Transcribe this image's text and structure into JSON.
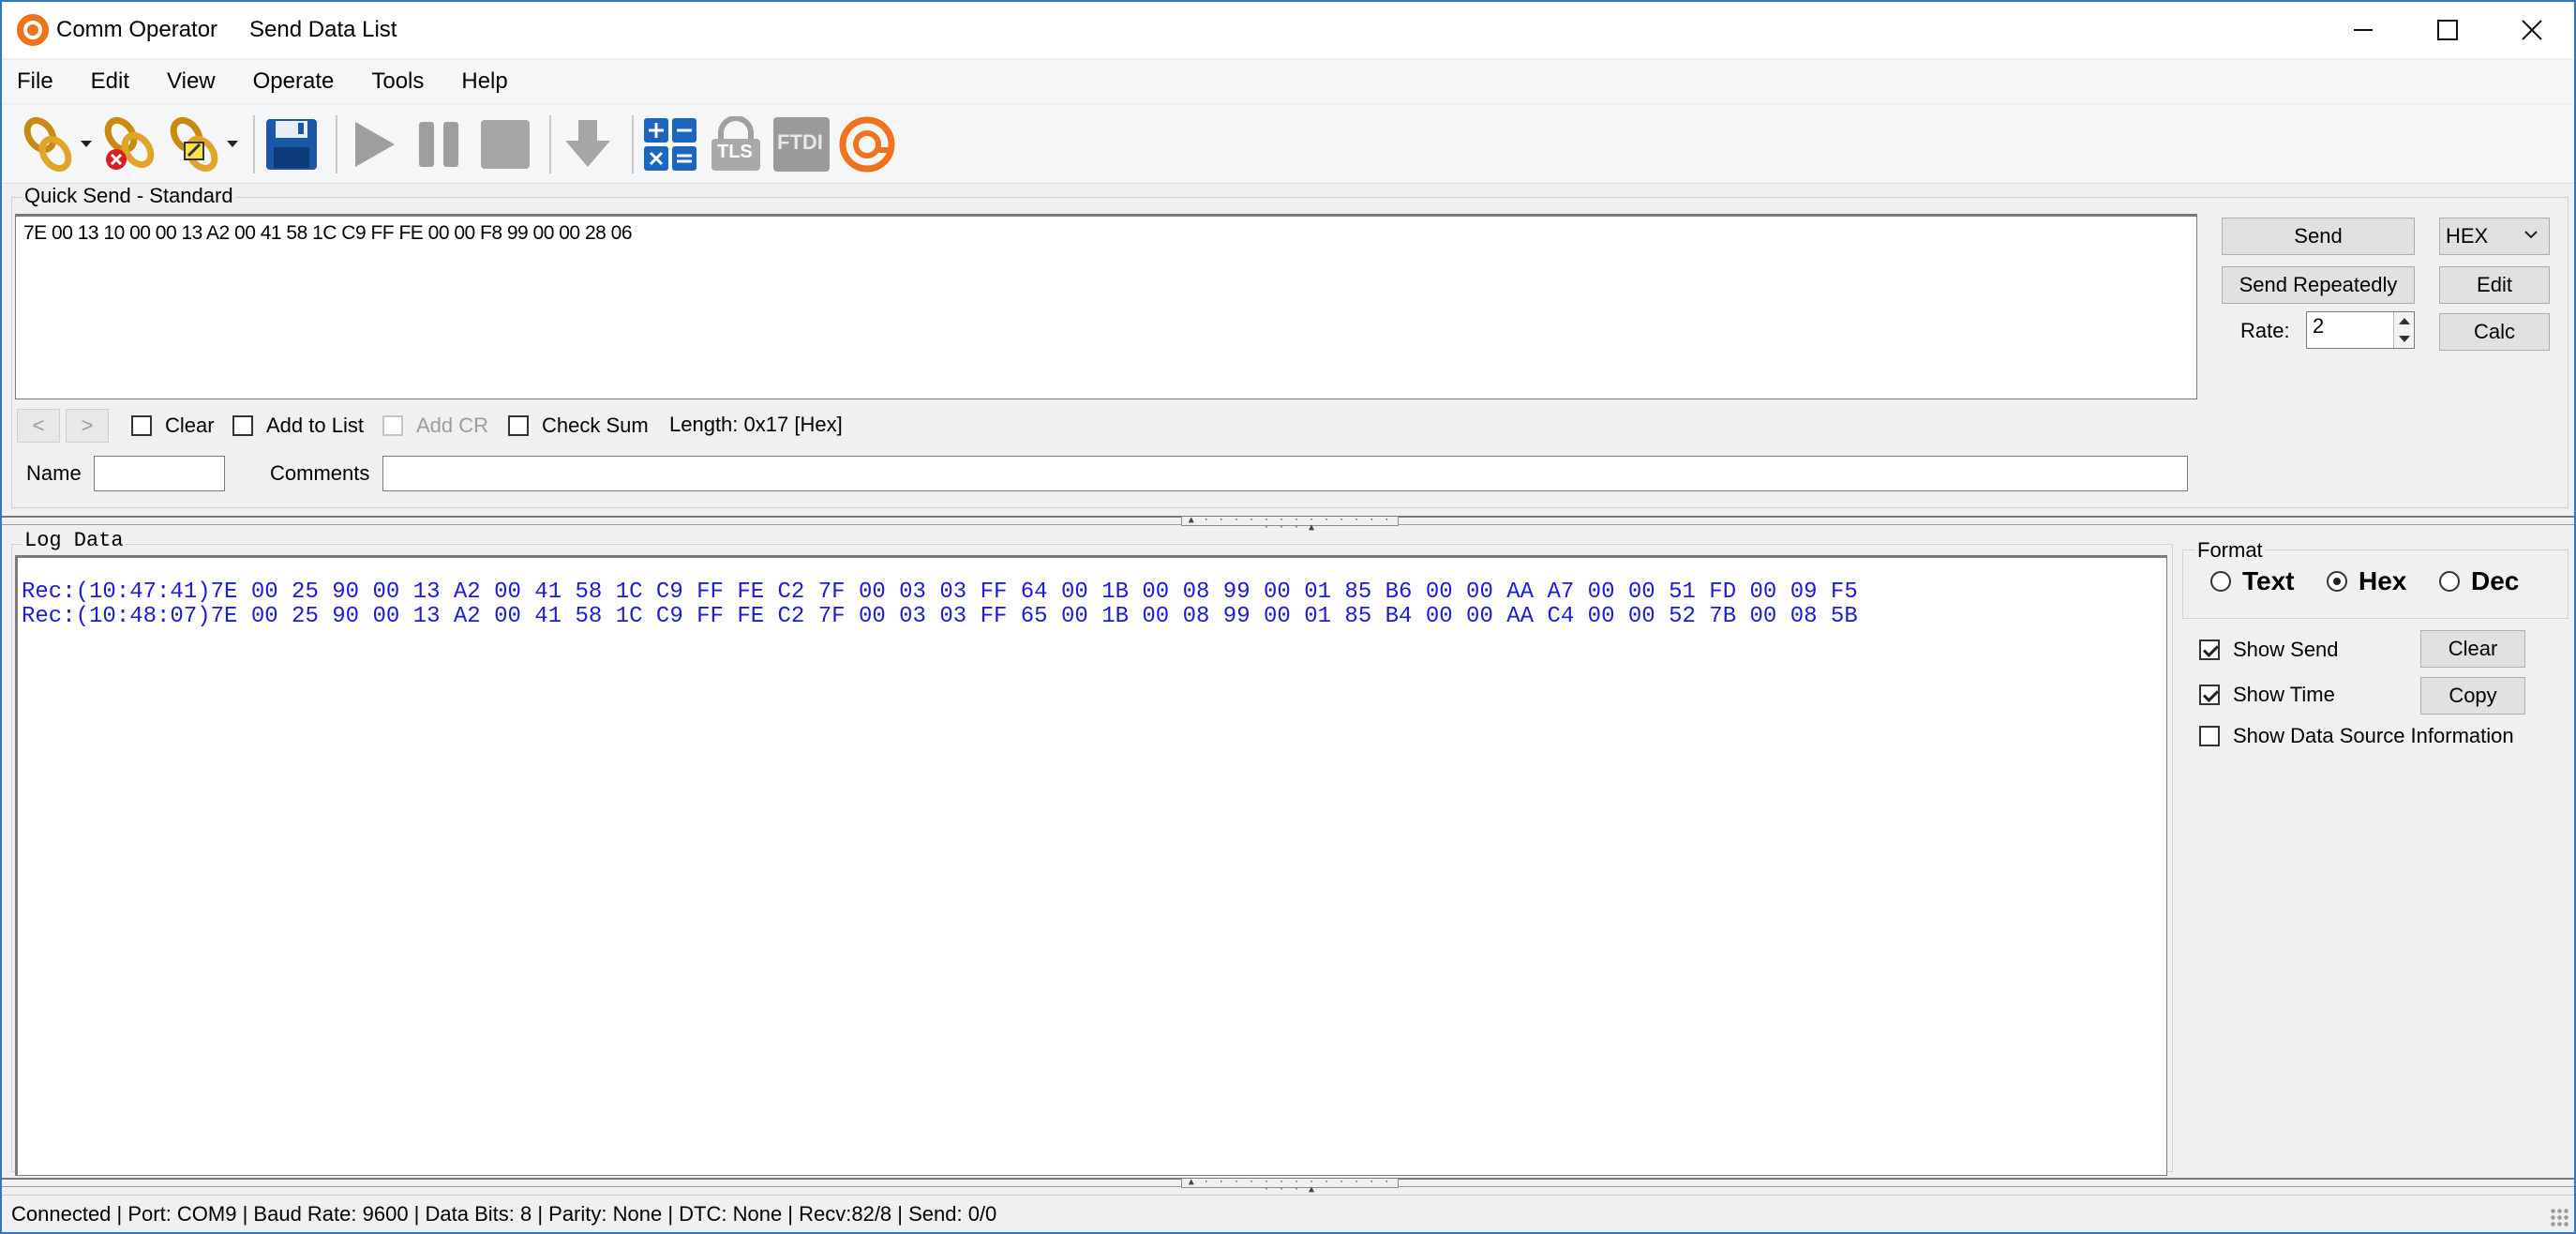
{
  "window": {
    "app_title": "Comm Operator",
    "doc_title": "Send Data List",
    "minimize": "—",
    "maximize": "☐",
    "close": "✕"
  },
  "menu": [
    "File",
    "Edit",
    "View",
    "Operate",
    "Tools",
    "Help"
  ],
  "toolbar": {
    "icons": [
      "connect-icon",
      "disconnect-icon",
      "connect-config-icon",
      "save-icon",
      "play-icon",
      "pause-icon",
      "stop-icon",
      "download-icon",
      "calculator-icon",
      "tls-icon",
      "ftdi-icon",
      "comm-operator-logo-icon"
    ],
    "tls_label": "TLS",
    "ftdi_label": "FTDI"
  },
  "quick_send": {
    "group_title": "Quick Send - Standard",
    "data": "7E 00 13 10 00 00 13 A2 00 41 58 1C C9 FF FE 00 00 F8 99 00 00 28 06",
    "prev": "<",
    "next": ">",
    "clear_label": "Clear",
    "add_to_list_label": "Add to List",
    "add_cr_label": "Add CR",
    "check_sum_label": "Check Sum",
    "length_text": "Length: 0x17 [Hex]",
    "name_label": "Name",
    "name_value": "",
    "comments_label": "Comments",
    "comments_value": "",
    "send_label": "Send",
    "send_repeatedly_label": "Send Repeatedly",
    "rate_label": "Rate:",
    "rate_value": "2",
    "format_value": "HEX",
    "edit_label": "Edit",
    "calc_label": "Calc"
  },
  "log": {
    "group_title": "Log Data",
    "lines": [
      "Rec:(10:47:41)7E 00 25 90 00 13 A2 00 41 58 1C C9 FF FE C2 7F 00 03 03 FF 64 00 1B 00 08 99 00 01 85 B6 00 00 AA A7 00 00 51 FD 00 09 F5",
      "Rec:(10:48:07)7E 00 25 90 00 13 A2 00 41 58 1C C9 FF FE C2 7F 00 03 03 FF 65 00 1B 00 08 99 00 01 85 B4 00 00 AA C4 00 00 52 7B 00 08 5B"
    ]
  },
  "format": {
    "title": "Format",
    "text_label": "Text",
    "hex_label": "Hex",
    "dec_label": "Dec",
    "selected": "Hex"
  },
  "log_options": {
    "show_send_label": "Show Send",
    "show_time_label": "Show Time",
    "show_source_label": "Show Data Source Information",
    "clear_label": "Clear",
    "copy_label": "Copy"
  },
  "status": {
    "text": "Connected | Port: COM9 | Baud Rate: 9600 | Data Bits: 8 | Parity: None | DTC: None | Recv:82/8 | Send: 0/0"
  }
}
